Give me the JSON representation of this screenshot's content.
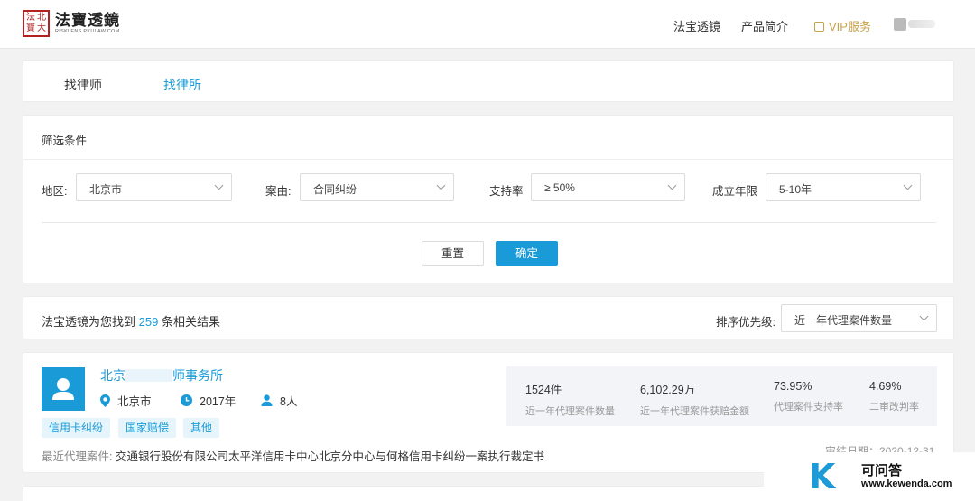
{
  "brand": {
    "seal": [
      "法",
      "北",
      "寶",
      "大"
    ],
    "title": "法寶透鏡",
    "subtitle": "RISKLENS.PKULAW.COM"
  },
  "nav": {
    "items": [
      "法宝透镜",
      "产品简介"
    ],
    "vip": "VIP服务"
  },
  "tabs": [
    "找律师",
    "找律所"
  ],
  "filters": {
    "title": "筛选条件",
    "region_label": "地区:",
    "region_value": "北京市",
    "cause_label": "案由:",
    "cause_value": "合同纠纷",
    "support_label": "支持率",
    "support_value": "≥ 50%",
    "years_label": "成立年限",
    "years_value": "5-10年",
    "reset": "重置",
    "confirm": "确定"
  },
  "results": {
    "prefix": "法宝透镜为您找到",
    "count": "259",
    "suffix": "条相关结果",
    "sort_label": "排序优先级:",
    "sort_value": "近一年代理案件数量"
  },
  "firm": {
    "name_start": "北京",
    "name_end": "师事务所",
    "city": "北京市",
    "year": "2017年",
    "people": "8人",
    "tags": [
      "信用卡纠纷",
      "国家赔偿",
      "其他"
    ],
    "recent_label": "最近代理案件:",
    "recent_case": "交通银行股份有限公司太平洋信用卡中心北京分中心与何格信用卡纠纷一案执行裁定书",
    "date_partial": "审结日期：2020-12-31",
    "stats": [
      {
        "value": "1524件",
        "desc": "近一年代理案件数量"
      },
      {
        "value": "6,102.29万",
        "desc": "近一年代理案件获赔金额"
      },
      {
        "value": "73.95%",
        "desc": "代理案件支持率"
      },
      {
        "value": "4.69%",
        "desc": "二审改判率"
      }
    ]
  },
  "watermark": {
    "letter": "K",
    "title": "可问答",
    "url": "www.kewenda.com"
  },
  "colors": {
    "accent": "#1a9bd7",
    "vip": "#c8a24a",
    "seal": "#b22222"
  }
}
